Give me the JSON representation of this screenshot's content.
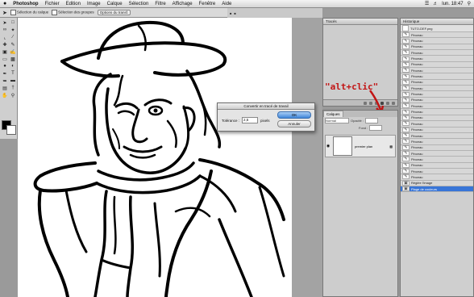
{
  "menubar": {
    "app": "Photoshop",
    "items": [
      "Fichier",
      "Edition",
      "Image",
      "Calque",
      "Sélection",
      "Filtre",
      "Affichage",
      "Fenêtre",
      "Aide"
    ],
    "clock": "lun. 18:47"
  },
  "options_bar": {
    "opt1": "Sélection du calque",
    "opt2": "Sélection des groupes",
    "opt3": "Options du transf."
  },
  "panels": {
    "tracks_title": "Tracés",
    "layers_tab": "Calques",
    "layer_mode": "Normal",
    "opacity_label": "Opacité :",
    "fill_label": "Fond :",
    "layer_name": "premier plan"
  },
  "history": {
    "title": "Historique",
    "snapshot": "TUTO-DEF.png",
    "item": "Pinceau",
    "count": 25,
    "last_items": [
      "Réglée l'image",
      "Plage de couleurs"
    ]
  },
  "dialog": {
    "title": "Convertir en tracé de travail",
    "tolerance_label": "Tolérance :",
    "tolerance_value": "2,5",
    "unit": "pixels",
    "ok": "OK",
    "cancel": "Annuler"
  },
  "annotation": {
    "text": "\"alt+clic\"",
    "color": "#c21414"
  },
  "icons": {
    "fg_color": "#000000",
    "bg_color": "#ffffff"
  }
}
